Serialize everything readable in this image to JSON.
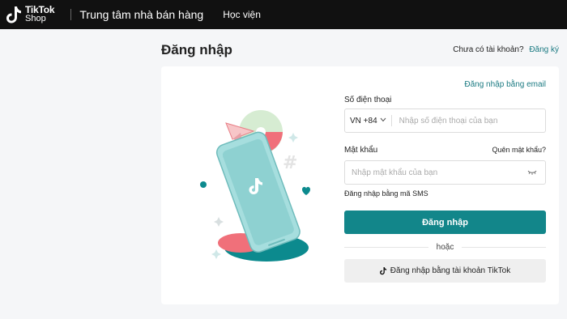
{
  "header": {
    "logo_line1": "TikTok",
    "logo_line2": "Shop",
    "center_title": "Trung tâm nhà bán hàng",
    "nav_academy": "Học viện"
  },
  "page": {
    "title": "Đăng nhập",
    "no_account_text": "Chưa có tài khoản?",
    "signup_link": "Đăng ký"
  },
  "form": {
    "email_login_link": "Đăng nhập bằng email",
    "phone_label": "Số điện thoại",
    "country_code": "VN +84",
    "phone_placeholder": "Nhập số điện thoại của bạn",
    "password_label": "Mật khẩu",
    "forgot_password": "Quên mật khẩu?",
    "password_placeholder": "Nhập mật khẩu của bạn",
    "sms_login_link": "Đăng nhập bằng mã SMS",
    "login_button": "Đăng nhập",
    "or_text": "hoặc",
    "tiktok_login_button": "Đăng nhập bằng tài khoản TikTok"
  },
  "colors": {
    "accent": "#12868a",
    "link": "#1b7a82",
    "topbar": "#111111"
  },
  "icons": {
    "logo": "tiktok-logo-icon",
    "chevron": "chevron-down-icon",
    "eye": "eye-closed-icon",
    "tiktok_button": "tiktok-icon"
  }
}
